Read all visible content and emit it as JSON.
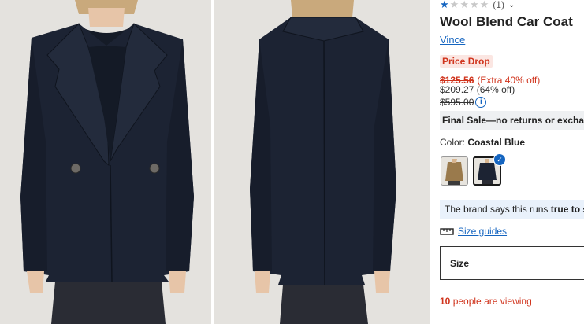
{
  "product": {
    "rating": {
      "filled_stars": 1,
      "total_stars": 5,
      "count": "(1)"
    },
    "title": "Wool Blend Car Coat",
    "brand": "Vince",
    "badge": "Price Drop",
    "price_sale": "$125.56",
    "price_extra": "(Extra 40% off)",
    "price_was": "$209.27",
    "price_was_pct": "(64% off)",
    "price_original": "$595.00",
    "final_sale": "Final Sale—no returns or exchanges",
    "color_label": "Color:",
    "color_value": "Coastal Blue",
    "fit_note_prefix": "The brand says this runs ",
    "fit_note_bold": "true to size",
    "size_guides": "Size guides",
    "size_label": "Size",
    "viewing_count": "10",
    "viewing_text": " people are viewing"
  },
  "colors": {
    "accent": "#1565c0",
    "sale": "#d0341d",
    "coat": "#1b2232",
    "background": "#e3e1dd"
  },
  "icons": {
    "star": "star-icon",
    "chevron": "chevron-down-icon",
    "info": "info-icon",
    "ruler": "ruler-icon",
    "check": "check-icon"
  }
}
